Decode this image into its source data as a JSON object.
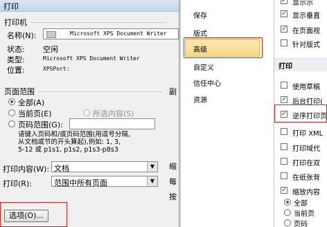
{
  "dialog": {
    "title": "打印",
    "printer_group": "打印机",
    "name_label": "名称(N):",
    "printer_name": "Microsoft XPS Document Writer",
    "status_label": "状态:",
    "status_value": "空闲",
    "type_label": "类型:",
    "type_value": "Microsoft XPS Document Writer",
    "where_label": "位置:",
    "where_value": "XPSPort:",
    "range_group": "页面范围",
    "radio_all": "全部(A)",
    "radio_current": "当前页(E)",
    "radio_selection": "所选内容(S)",
    "radio_pages": "页码范围(G):",
    "hint_line1": "请键入页码和/或页码范围(用逗号分隔,",
    "hint_line2": "从文档或节的开头算起),例如: 1, 3,",
    "hint_line3": "5-12 或 p1s1, p1s2, p1s3-p8s3",
    "print_what_label": "打印内容(W):",
    "print_what_value": "文档",
    "print_label": "打印(R):",
    "print_value": "范围中所有页面",
    "options_button": "选项(O)...",
    "partial_right_1": "副",
    "partial_right_2": "缩",
    "partial_right_3": "每",
    "partial_right_4": "按"
  },
  "nav": {
    "items": [
      "保存",
      "版式",
      "高级",
      "自定义",
      "信任中心",
      "资源"
    ],
    "selected": "高级"
  },
  "right": {
    "top_items": [
      {
        "label": "显示示",
        "checked": true
      },
      {
        "label": "显示垂直",
        "checked": true
      },
      {
        "label": "在页面视",
        "checked": true
      },
      {
        "label": "针对版式",
        "checked": false
      }
    ],
    "section": "打印",
    "print_items": [
      {
        "label": "使用草稿",
        "checked": false
      },
      {
        "label": "后台打印(",
        "checked": true
      },
      {
        "label": "逆序打印页",
        "checked": true
      },
      {
        "label": "打印 XML",
        "checked": false
      },
      {
        "label": "打印域代",
        "checked": false
      },
      {
        "label": "打印在双",
        "checked": false
      },
      {
        "label": "在纸张背",
        "checked": false
      },
      {
        "label": "缩放内容",
        "checked": true
      }
    ],
    "sub_radio_1": "全部",
    "sub_radio_2": "当前页",
    "sub_radio_3": "页码"
  },
  "colors": {
    "highlight": "#f9d884",
    "annotation_red": "#d0261c"
  }
}
